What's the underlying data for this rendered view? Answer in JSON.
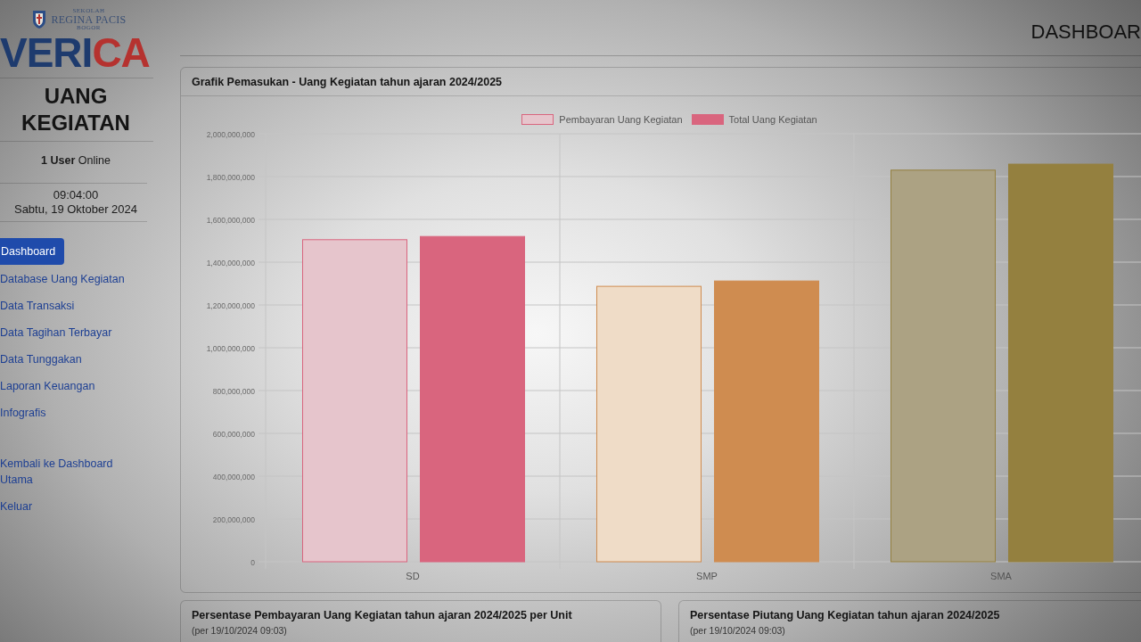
{
  "sidebar": {
    "logo": {
      "school_label": "SEKOLAH",
      "school_name": "REGINA PACIS",
      "city": "BOGOR",
      "wordmark": [
        {
          "text": "VERI",
          "color": "#1e3b6e"
        },
        {
          "text": "CA",
          "color": "#b5322f"
        }
      ]
    },
    "module_title": "UANG KEGIATAN",
    "online": "**1 User** Online",
    "clock": {
      "time": "09:04:00",
      "date": "Sabtu, 19 Oktober 2024"
    },
    "nav": [
      {
        "label": "Dashboard",
        "selected": true
      },
      {
        "label": "Database Uang Kegiatan",
        "selected": false
      },
      {
        "label": "Data Transaksi",
        "selected": false
      },
      {
        "label": "Data Tagihan Terbayar",
        "selected": false
      },
      {
        "label": "Data Tunggakan",
        "selected": false
      },
      {
        "label": "Laporan Keuangan",
        "selected": false
      },
      {
        "label": "Infografis",
        "selected": false
      }
    ],
    "nav_bottom": [
      {
        "label": "Kembali ke Dashboard Utama",
        "selected": false
      },
      {
        "label": "Keluar",
        "selected": false
      }
    ]
  },
  "header": {
    "title": "DASHBOAR"
  },
  "income_chart": {
    "title": "Grafik Pemasukan - Uang Kegiatan tahun ajaran 2024/2025",
    "chart_data": {
      "type": "bar",
      "grid": true,
      "legend": "top",
      "categories": [
        "SD",
        "SMP",
        "SMA"
      ],
      "series": [
        {
          "name": "Pembayaran Uang Kegiatan",
          "color": "#e6c5cc",
          "colors": [
            "#e6c5cc",
            "#efdcc7",
            "#aca283"
          ],
          "values": [
            1505000000,
            1287000000,
            1830000000
          ]
        },
        {
          "name": "Total Uang Kegiatan",
          "color": "#d9657e",
          "colors": [
            "#d9657e",
            "#cf8c50",
            "#94803f"
          ],
          "values": [
            1520000000,
            1312000000,
            1858000000
          ]
        }
      ],
      "ylim": [
        0,
        2000000000
      ],
      "yticks": [
        0,
        {
          "value": 200000000,
          "label": "200,000,000"
        },
        {
          "value": 400000000,
          "label": "400,000,000"
        },
        {
          "value": 600000000,
          "label": "600,000,000"
        },
        {
          "value": 800000000,
          "label": "800,000,000"
        },
        {
          "value": 1000000000,
          "label": "1,000,000,000"
        },
        {
          "value": 1200000000,
          "label": "1,200,000,000"
        },
        {
          "value": 1400000000,
          "label": "1,400,000,000"
        },
        {
          "value": 1600000000,
          "label": "1,600,000,000"
        },
        {
          "value": 1800000000,
          "label": "1,800,000,000"
        },
        {
          "value": 2000000000,
          "label": "2,000,000,000"
        }
      ]
    }
  },
  "cards": [
    {
      "title": "Persentase Pembayaran Uang Kegiatan tahun ajaran 2024/2025 per Unit",
      "subtitle": "(per 19/10/2024 09:03)"
    },
    {
      "title": "Persentase Piutang Uang Kegiatan tahun ajaran 2024/2025",
      "subtitle": "(per 19/10/2024 09:03)"
    }
  ]
}
